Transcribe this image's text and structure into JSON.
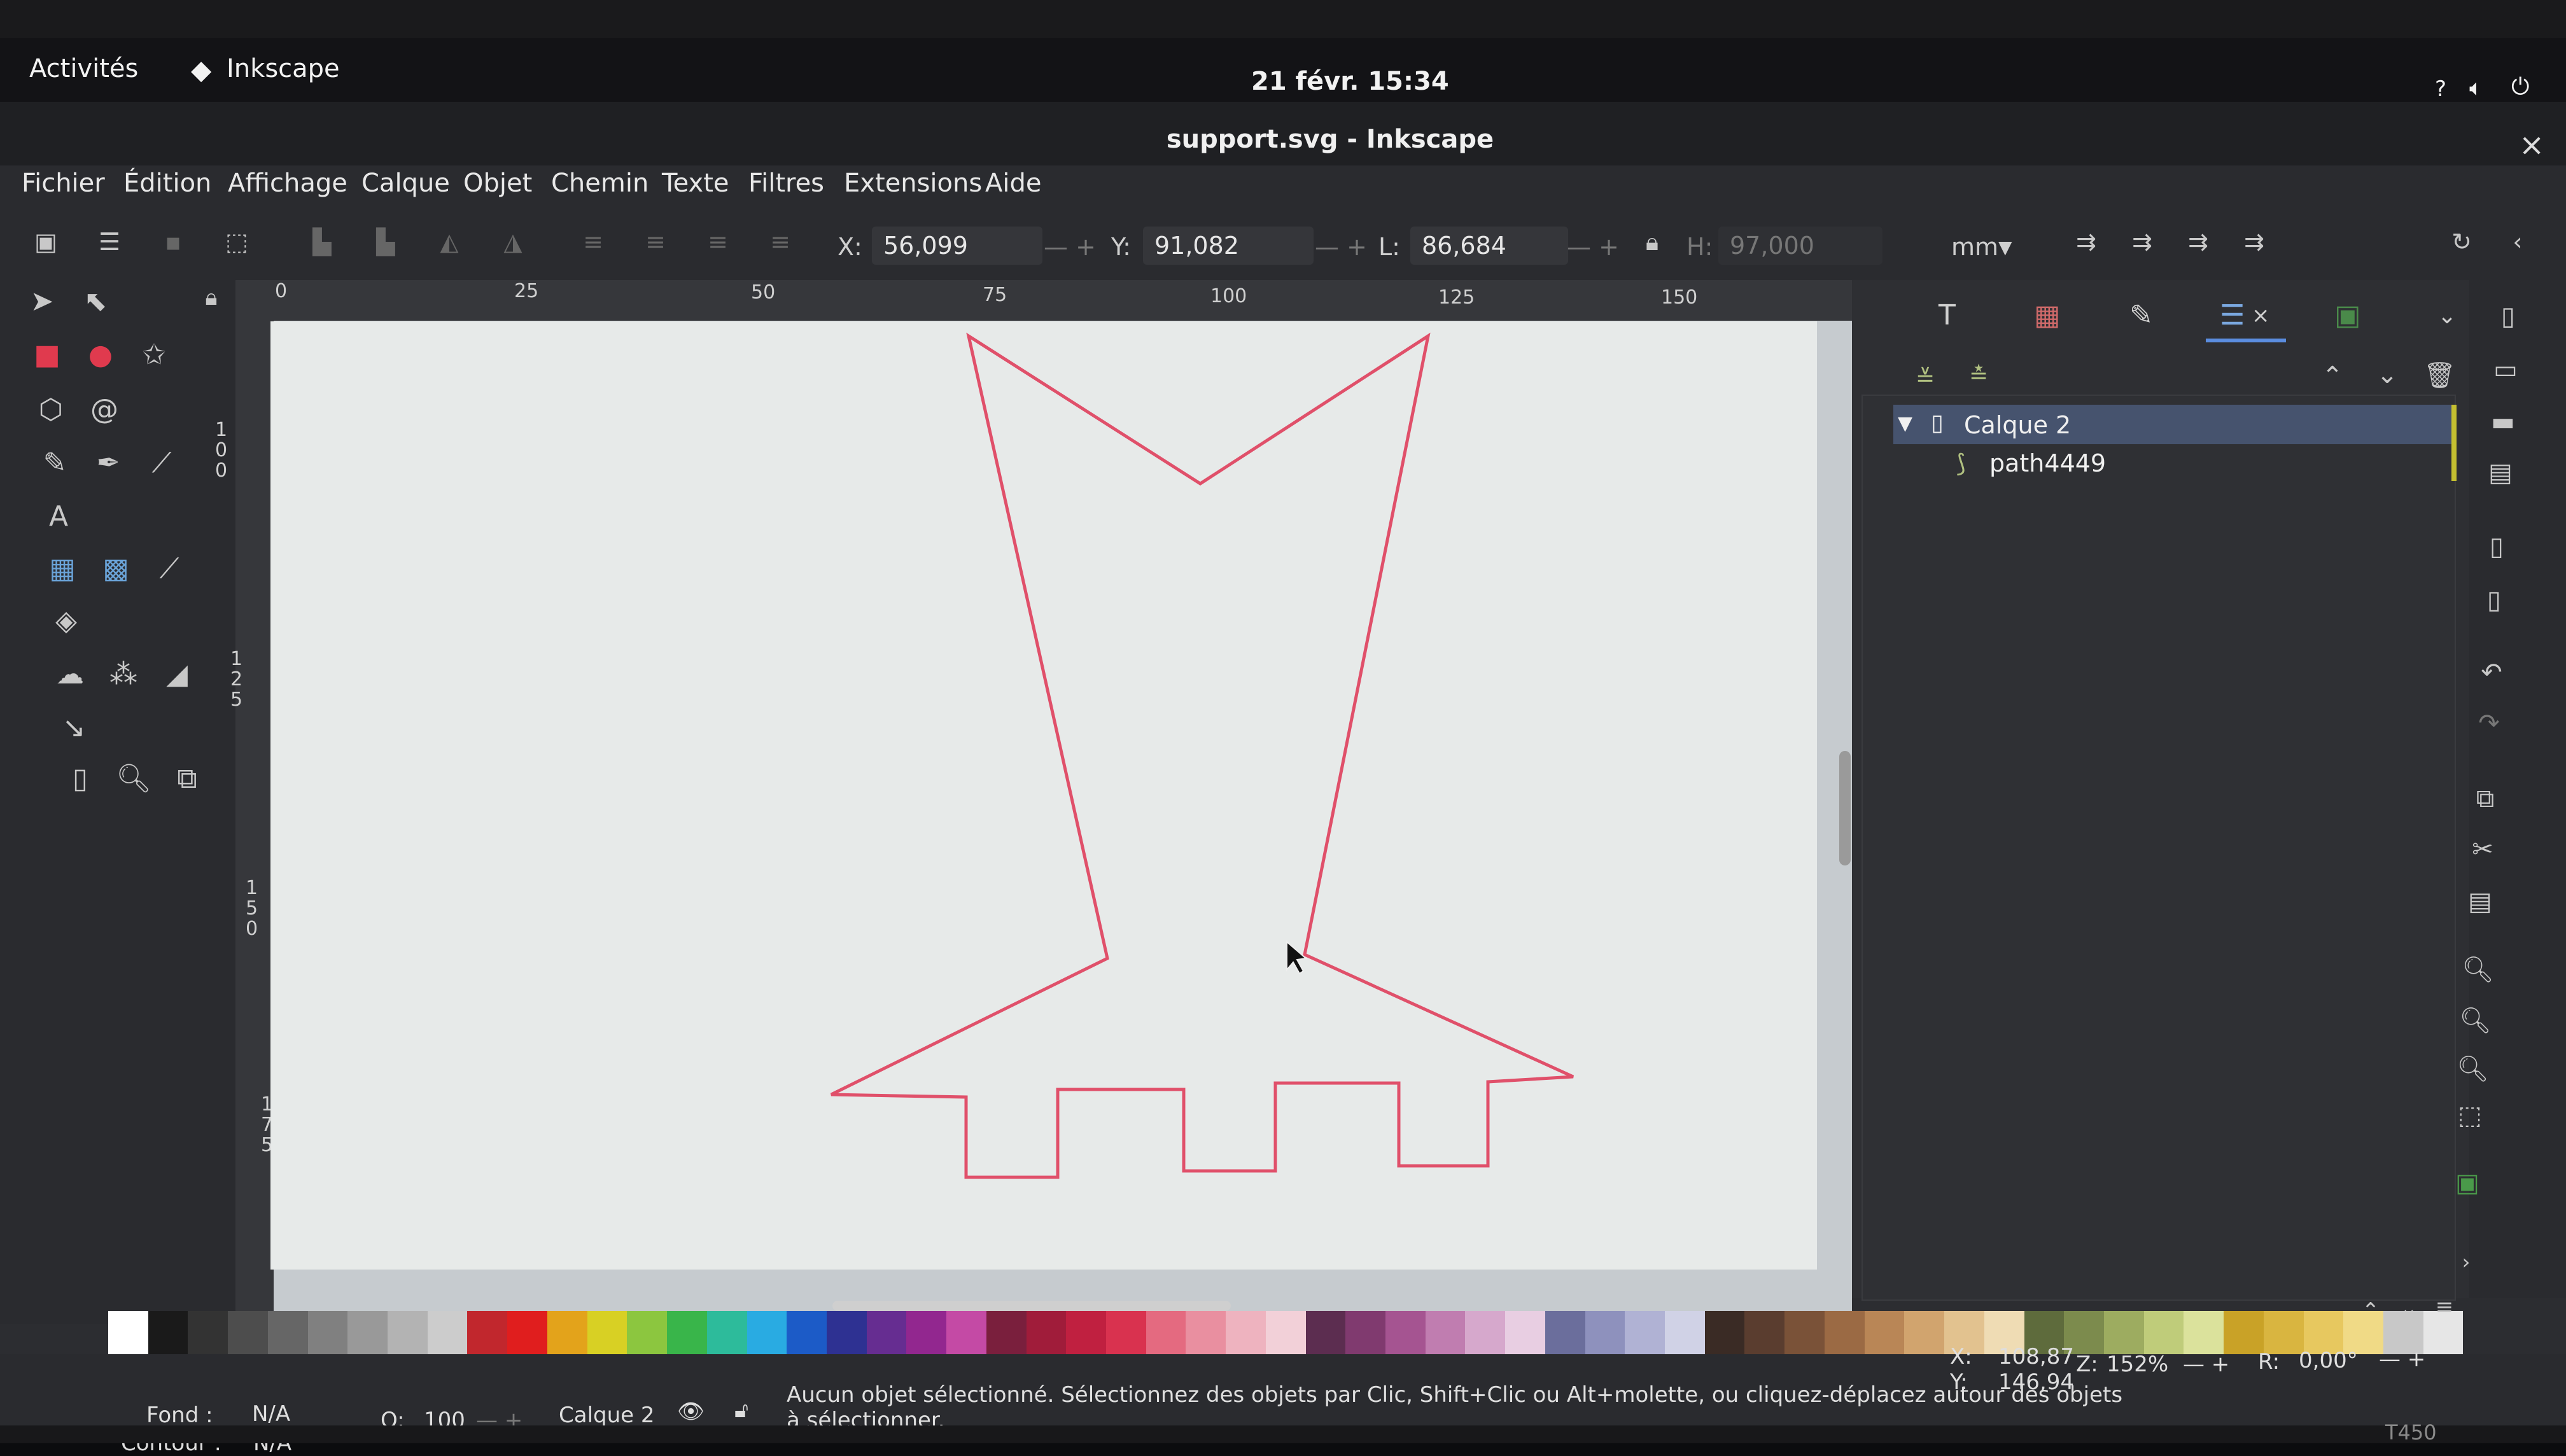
{
  "gnome_bar": {
    "activities": "Activités",
    "app_name": "Inkscape",
    "clock": "21 févr.  15:34",
    "help": "?"
  },
  "window": {
    "title": "support.svg - Inkscape",
    "close": "×"
  },
  "menu": [
    "Fichier",
    "Édition",
    "Affichage",
    "Calque",
    "Objet",
    "Chemin",
    "Texte",
    "Filtres",
    "Extensions",
    "Aide"
  ],
  "tool_controls": {
    "x_label": "X:",
    "x_value": "56,099",
    "y_label": "Y:",
    "y_value": "91,082",
    "w_label": "L:",
    "w_value": "86,684",
    "h_label": "H:",
    "h_value": "97,000",
    "unit": "mm"
  },
  "ruler_top": [
    "0",
    "25",
    "50",
    "75",
    "100",
    "125",
    "150"
  ],
  "ruler_left": [
    "1\n0\n0",
    "1\n2\n5",
    "1\n5\n0",
    "1\n7\n5"
  ],
  "layers": {
    "layer_name": "Calque 2",
    "path_name": "path4449"
  },
  "status": {
    "fill_label": "Fond :",
    "fill_value": "N/A",
    "stroke_label": "Contour :",
    "stroke_value": "N/A",
    "opacity_label": "O:",
    "opacity_value": "100",
    "layer": "Calque 2",
    "message_line1": "Aucun objet sélectionné. Sélectionnez des objets par Clic, Shift+Clic ou Alt+molette, ou cliquez-déplacez autour des objets",
    "message_line2": "à sélectionner.",
    "cursor_x_label": "X:",
    "cursor_x": "108,87",
    "cursor_y_label": "Y:",
    "cursor_y": "146,94",
    "zoom_label": "Z:",
    "zoom": "152%",
    "rotation_label": "R:",
    "rotation": "0,00°"
  },
  "laptop_model": "T450",
  "colors": {
    "path_stroke": "#e0506a",
    "selected_layer": "#46536e",
    "page": "#e7eae9"
  },
  "palette": [
    "#ffffff",
    "#1a1a1a",
    "#333333",
    "#4d4d4d",
    "#666666",
    "#808080",
    "#999999",
    "#b3b3b3",
    "#cccccc",
    "#c1272d",
    "#e01e1e",
    "#e3a31b",
    "#d8d024",
    "#8cc63f",
    "#39b54a",
    "#2dbb9b",
    "#29abe2",
    "#1c5bc7",
    "#2e3192",
    "#662d91",
    "#92278f",
    "#c44aa5",
    "#7a1f3d",
    "#a01c3a",
    "#c02040",
    "#d9324f",
    "#e46a80",
    "#e98fa0",
    "#eeb3bf",
    "#f2d0d8",
    "#5c2d50",
    "#803a6f",
    "#a55491",
    "#c07db0",
    "#d6a8cc",
    "#e8cee2",
    "#6b6e9c",
    "#8e91bd",
    "#b0b2d4",
    "#d0d2e6",
    "#3a2b25",
    "#5a3d2f",
    "#7a5238",
    "#9b6a44",
    "#b98656",
    "#d1a46e",
    "#e2c28f",
    "#efdcb4",
    "#5e6b3c",
    "#7c8b4d",
    "#9dac60",
    "#bfcc7a",
    "#dbe29c",
    "#c9a227",
    "#d9b540",
    "#e7c85f",
    "#f0da86",
    "#c8c8c8",
    "#e6e6e6"
  ]
}
